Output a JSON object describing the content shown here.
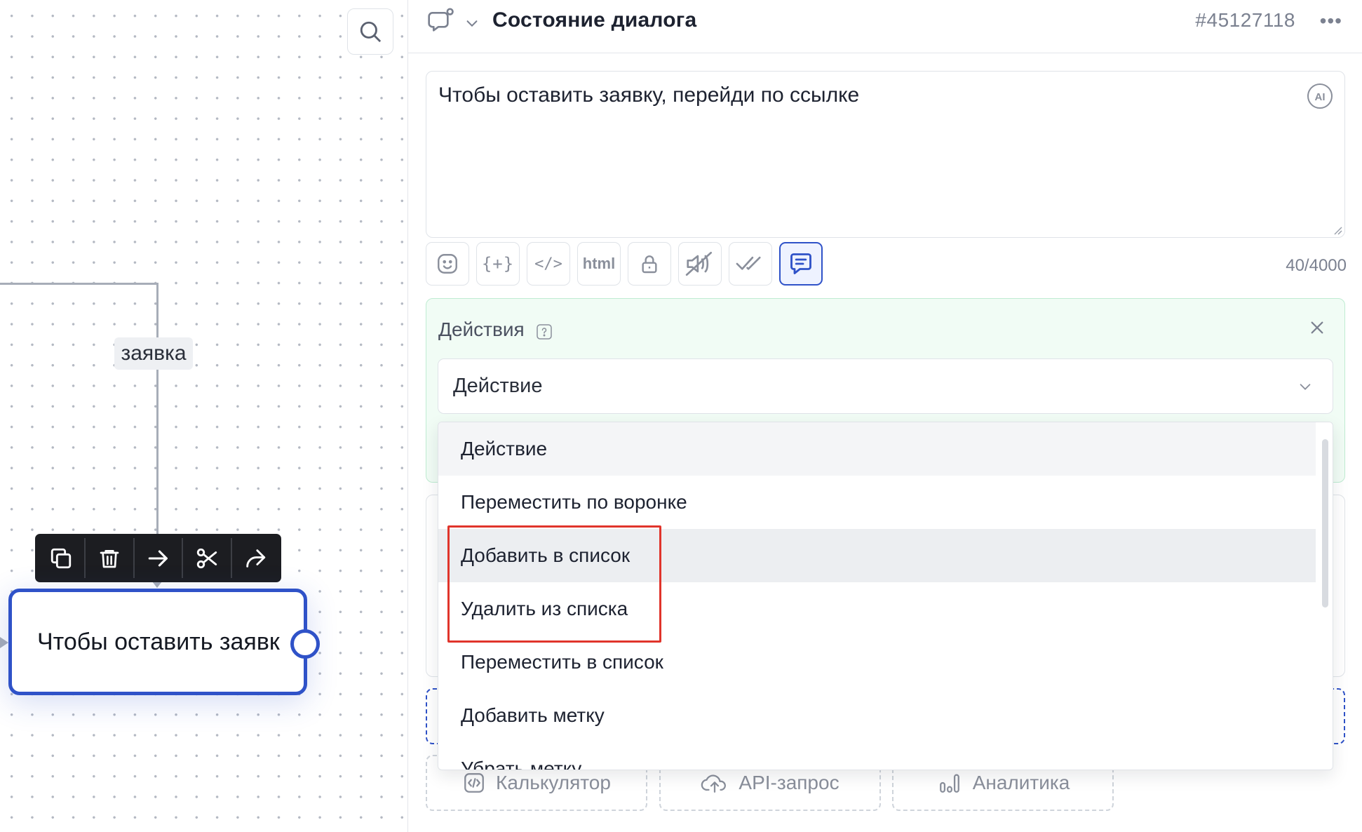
{
  "canvas": {
    "edge_label": "заявка",
    "node_text": "Чтобы оставить заявк",
    "search_icon": "search-icon",
    "toolbar": [
      "copy-icon",
      "trash-icon",
      "arrow-right-icon",
      "scissors-icon",
      "share-icon"
    ]
  },
  "header": {
    "title": "Состояние диалога",
    "id": "#45127118",
    "more": "•••"
  },
  "message": {
    "text": "Чтобы оставить заявку, перейди по ссылке",
    "ai_label": "AI",
    "counter": "40/4000"
  },
  "format_buttons": [
    {
      "name": "emoji-icon",
      "label": ""
    },
    {
      "name": "variable-icon",
      "label": "{+}"
    },
    {
      "name": "code-icon",
      "label": "</>"
    },
    {
      "name": "html-button",
      "label": "html"
    },
    {
      "name": "lock-icon",
      "label": ""
    },
    {
      "name": "mute-icon",
      "label": ""
    },
    {
      "name": "double-check-icon",
      "label": ""
    },
    {
      "name": "chat-bubble-icon",
      "label": ""
    }
  ],
  "actions": {
    "title": "Действия",
    "select_value": "Действие",
    "options": [
      "Действие",
      "Переместить по воронке",
      "Добавить в список",
      "Удалить из списка",
      "Переместить в список",
      "Добавить метку",
      "Убрать метку"
    ]
  },
  "tiles": [
    {
      "icon": "code-icon",
      "label": "Калькулятор"
    },
    {
      "icon": "cloud-upload-icon",
      "label": "API-запрос"
    },
    {
      "icon": "bar-chart-icon",
      "label": "Аналитика"
    }
  ],
  "colors": {
    "accent": "#2f52c8",
    "highlight_frame": "#e0342b",
    "actions_bg": "#f1fcf5"
  }
}
